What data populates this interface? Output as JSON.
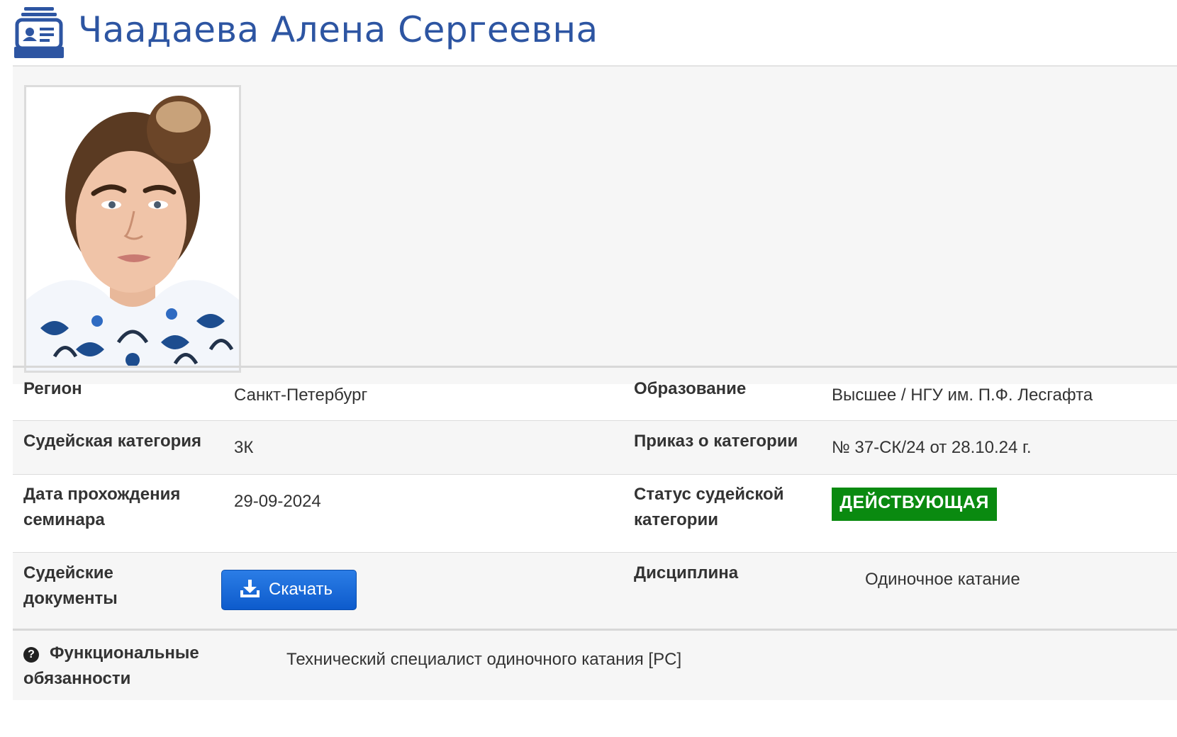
{
  "header": {
    "icon": "id-badge-icon",
    "title": "Чаадаева Алена Сергеевна",
    "title_color": "#2d55a2"
  },
  "photo": {
    "alt": "Чаадаева Алена Сергеевна"
  },
  "fields": {
    "region": {
      "label": "Регион",
      "value": "Санкт-Петербург"
    },
    "education": {
      "label": "Образование",
      "value": "Высшее / НГУ им. П.Ф. Лесгафта"
    },
    "category": {
      "label": "Судейская категория",
      "value": "3К"
    },
    "order": {
      "label": "Приказ о категории",
      "value": "№ 37-СК/24 от 28.10.24 г."
    },
    "seminar": {
      "label_line1": "Дата прохождения",
      "label_line2": "семинара",
      "value": "29-09-2024"
    },
    "status": {
      "label_line1": "Статус судейской",
      "label_line2": "категории",
      "value": "ДЕЙСТВУЮЩАЯ",
      "color": "#0a8a10"
    },
    "documents": {
      "label_line1": "Судейские",
      "label_line2": "документы",
      "button_label": "Скачать",
      "button_icon": "download-icon"
    },
    "discipline": {
      "label": "Дисциплина",
      "value": "Одиночное катание"
    },
    "duties": {
      "icon": "question-circle-icon",
      "label_line1": "Функциональные",
      "label_line2": "обязанности",
      "value": "Технический специалист одиночного катания [PC]"
    }
  }
}
